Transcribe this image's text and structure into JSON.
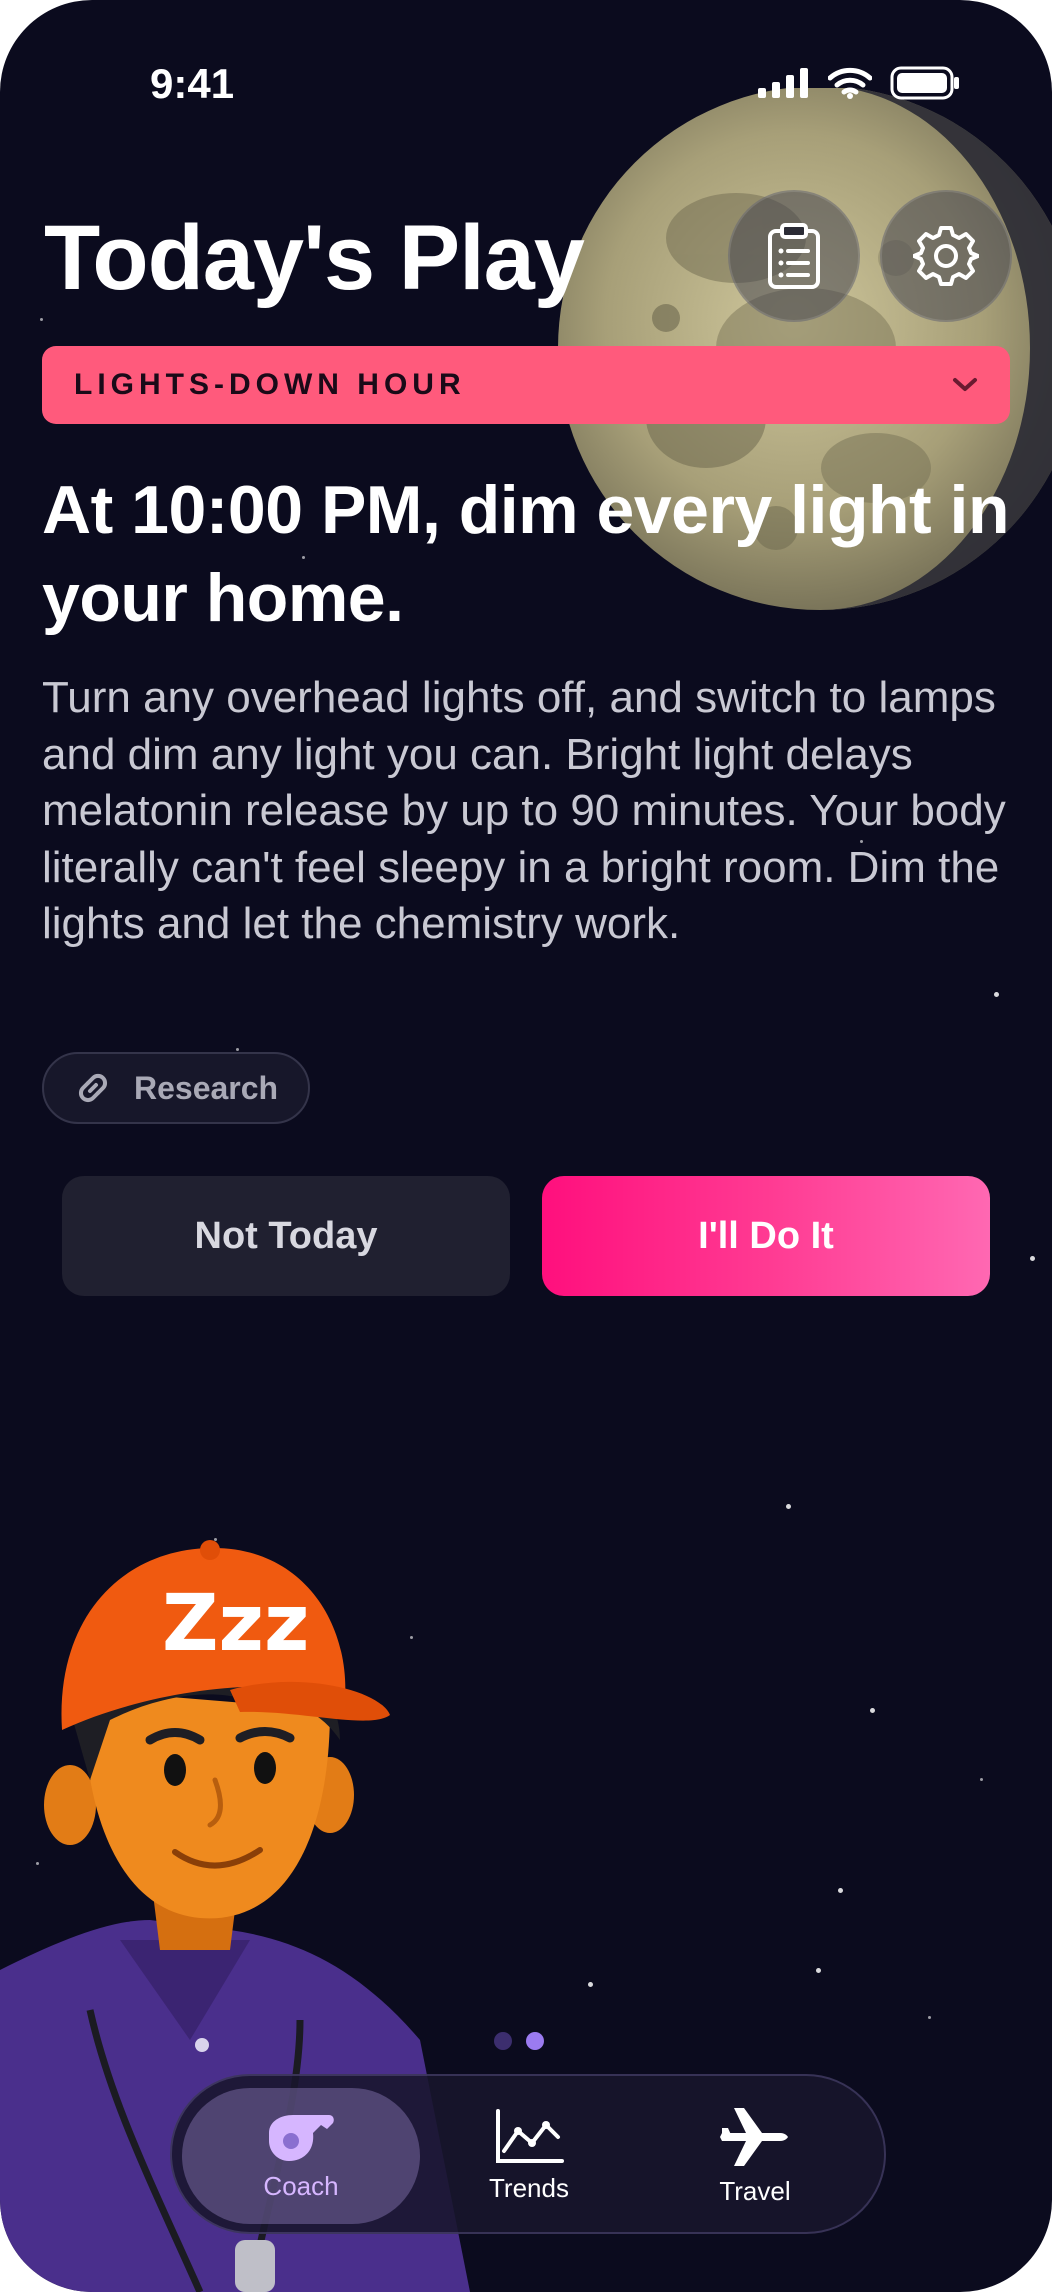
{
  "status_bar": {
    "time": "9:41"
  },
  "header": {
    "title": "Today's Play"
  },
  "banner": {
    "label": "LIGHTS-DOWN HOUR"
  },
  "tip": {
    "headline": "At 10:00 PM, dim every light in your home.",
    "body": "Turn any overhead lights off, and switch to lamps and dim any light you can. Bright light delays melatonin release by up to 90 minutes. Your body literally can't feel sleepy in a bright room. Dim the lights and let the chemistry work."
  },
  "research": {
    "label": "Research"
  },
  "actions": {
    "decline_label": "Not Today",
    "accept_label": "I'll Do It"
  },
  "mascot": {
    "cap_text": "Zzz"
  },
  "pager": {
    "count": 2,
    "active_index": 1
  },
  "tabs": [
    {
      "label": "Coach",
      "icon": "whistle-icon",
      "active": true
    },
    {
      "label": "Trends",
      "icon": "chart-icon",
      "active": false
    },
    {
      "label": "Travel",
      "icon": "airplane-icon",
      "active": false
    }
  ],
  "colors": {
    "background": "#0b0b1e",
    "banner": "#ff5a7c",
    "accent_pink": "#ff1f86",
    "tab_active": "#d6b6ff"
  }
}
